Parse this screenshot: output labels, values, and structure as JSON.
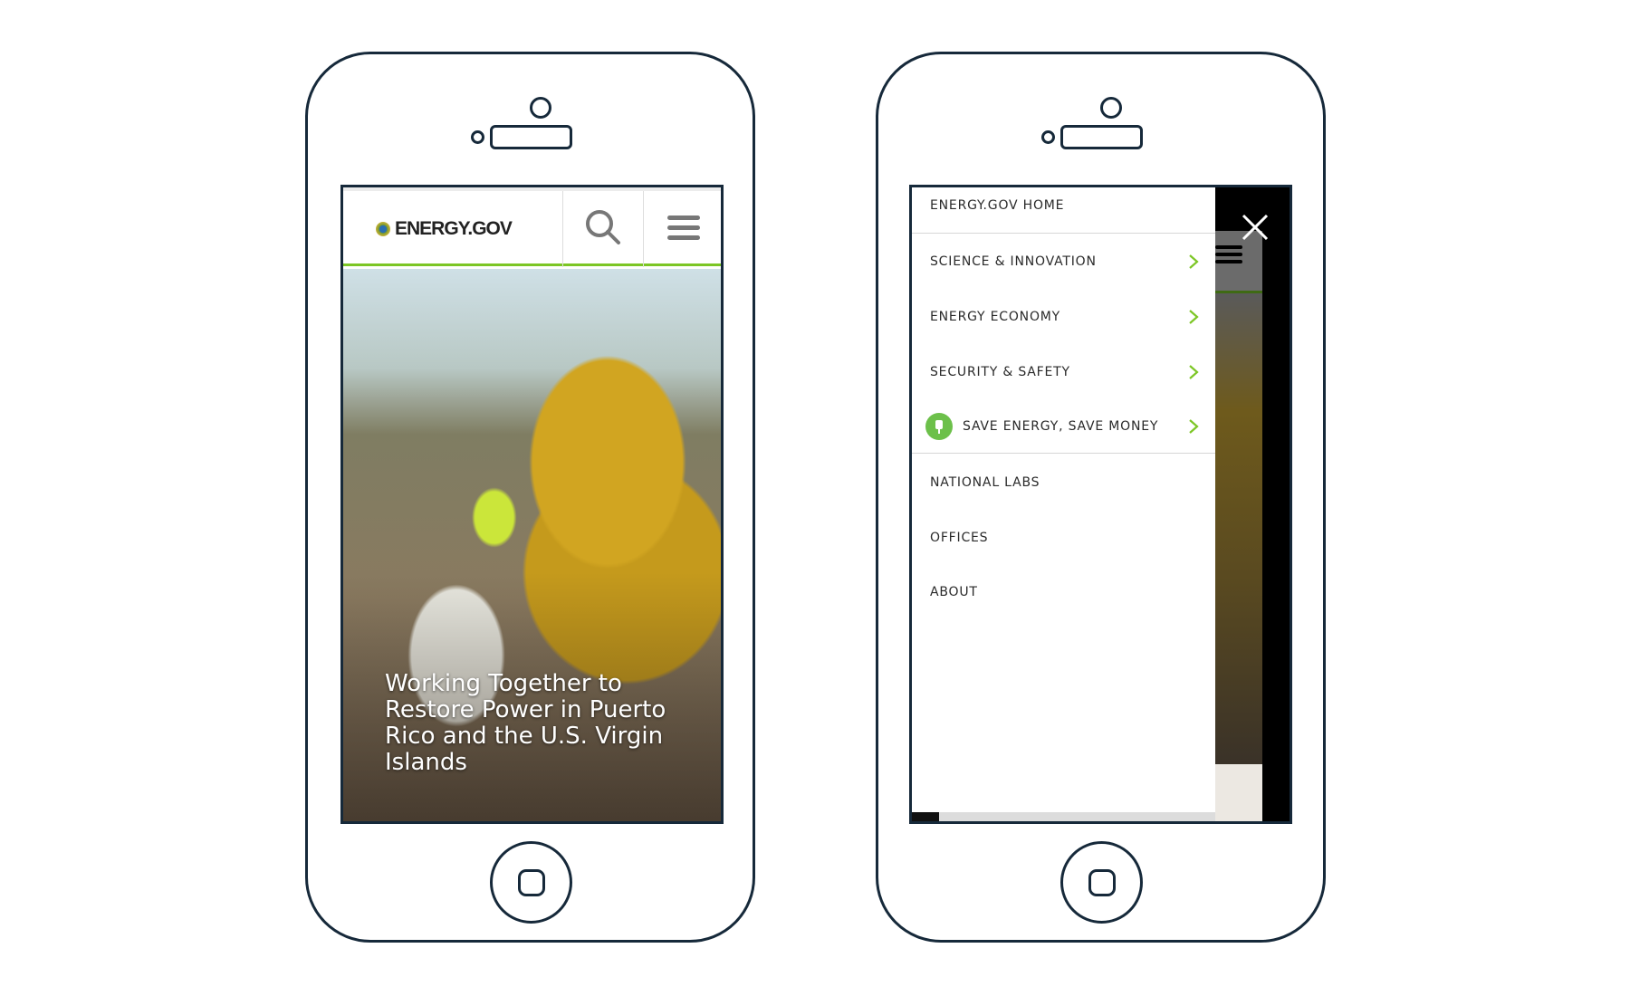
{
  "left_phone": {
    "logo_text": "ENERGY.GOV",
    "search_icon": "search-icon",
    "menu_icon": "hamburger-icon",
    "headline": "Working Together to Restore Power in Puerto Rico and the U.S. Virgin Islands"
  },
  "right_phone": {
    "close_icon": "close-icon",
    "menu_items": [
      {
        "label": "ENERGY.GOV HOME",
        "chevron": false
      },
      {
        "label": "SCIENCE & INNOVATION",
        "chevron": true
      },
      {
        "label": "ENERGY ECONOMY",
        "chevron": true
      },
      {
        "label": "SECURITY & SAFETY",
        "chevron": true
      },
      {
        "label": "SAVE ENERGY, SAVE MONEY",
        "chevron": true,
        "icon": "house-plug-icon"
      },
      {
        "label": "NATIONAL LABS",
        "chevron": false
      },
      {
        "label": "OFFICES",
        "chevron": false
      },
      {
        "label": "ABOUT",
        "chevron": false
      }
    ]
  },
  "colors": {
    "accent_green": "#7cc625",
    "outline": "#16293a",
    "text": "#2a2a2a"
  }
}
